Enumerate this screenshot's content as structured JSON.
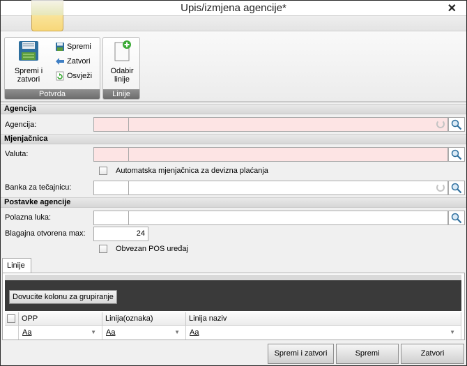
{
  "window": {
    "title": "Upis/izmjena agencije*",
    "close_label": "✕"
  },
  "ribbon": {
    "groups": [
      {
        "label": "Potvrda",
        "big_button": {
          "label_line1": "Spremi i",
          "label_line2": "zatvori",
          "icon": "floppy-disk-icon"
        },
        "small_buttons": [
          {
            "label": "Spremi",
            "icon": "save-icon"
          },
          {
            "label": "Zatvori",
            "icon": "arrow-left-icon"
          },
          {
            "label": "Osvježi",
            "icon": "refresh-icon"
          }
        ]
      },
      {
        "label": "Linije",
        "big_button": {
          "label_line1": "Odabir",
          "label_line2": "linije",
          "icon": "add-document-icon"
        }
      }
    ]
  },
  "sections": {
    "agencija": {
      "title": "Agencija",
      "field_label": "Agencija:"
    },
    "mjenjacnica": {
      "title": "Mjenjačnica",
      "valuta_label": "Valuta:",
      "auto_checkbox_label": "Automatska mjenjačnica za devizna plaćanja",
      "banka_label": "Banka za tečajnicu:"
    },
    "postavke": {
      "title": "Postavke agencije",
      "luka_label": "Polazna luka:",
      "blagajna_label": "Blagajna otvorena max:",
      "blagajna_value": "24",
      "pos_checkbox_label": "Obvezan POS uređaj"
    }
  },
  "tabs": [
    {
      "label": "Linije"
    }
  ],
  "grid": {
    "group_hint": "Dovucite kolonu za grupiranje",
    "columns": [
      "OPP",
      "Linija(oznaka)",
      "Linija naziv"
    ],
    "filter_placeholder": "Aa",
    "filter_dropdown": "▼"
  },
  "footer": {
    "save_close": "Spremi i zatvori",
    "save": "Spremi",
    "close": "Zatvori"
  },
  "colors": {
    "required_bg": "#fde4e4",
    "group_panel_bg": "#3a3a3a",
    "accent_green": "#3aa935"
  }
}
